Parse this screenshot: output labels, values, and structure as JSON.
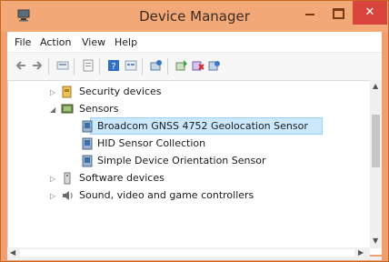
{
  "window": {
    "title": "Device Manager",
    "accent_color": "#f3a977",
    "close_color": "#d9453d"
  },
  "menu": {
    "items": [
      "File",
      "Action",
      "View",
      "Help"
    ]
  },
  "toolbar": {
    "icons": [
      "back-arrow-icon",
      "forward-arrow-icon",
      "show-hidden-icon",
      "properties-icon",
      "help-icon",
      "view-icon",
      "scan-hardware-icon",
      "update-driver-icon",
      "uninstall-icon",
      "enable-device-icon"
    ]
  },
  "tree": {
    "items": [
      {
        "label": "Security devices",
        "level": 0,
        "expanded": false,
        "icon": "security-devices-icon"
      },
      {
        "label": "Sensors",
        "level": 0,
        "expanded": true,
        "icon": "sensors-icon"
      },
      {
        "label": "Broadcom GNSS 4752 Geolocation Sensor",
        "level": 1,
        "selected": true,
        "icon": "sensor-device-icon"
      },
      {
        "label": "HID Sensor Collection",
        "level": 1,
        "icon": "sensor-device-icon"
      },
      {
        "label": "Simple Device Orientation Sensor",
        "level": 1,
        "icon": "sensor-device-icon"
      },
      {
        "label": "Software devices",
        "level": 0,
        "expanded": false,
        "icon": "software-devices-icon"
      },
      {
        "label": "Sound, video and game controllers",
        "level": 0,
        "expanded": false,
        "icon": "sound-icon"
      }
    ]
  }
}
